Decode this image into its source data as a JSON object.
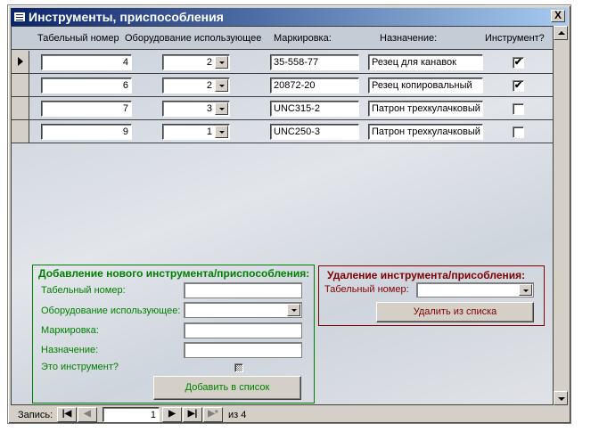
{
  "window": {
    "title": "Инструменты, приспособления",
    "close": "X"
  },
  "columns": [
    "Табельный номер",
    "Оборудование использующее",
    "Маркировка:",
    "Назначение:",
    "Инструмент?"
  ],
  "rows": [
    {
      "tab": "4",
      "equip": "2",
      "mark": "35-558-77",
      "purpose": "Резец для канавок",
      "tool": "✔",
      "current": true
    },
    {
      "tab": "6",
      "equip": "2",
      "mark": "20872-20",
      "purpose": "Резец копировальный",
      "tool": "✔",
      "current": false
    },
    {
      "tab": "7",
      "equip": "3",
      "mark": "UNC315-2",
      "purpose": "Патрон трехкулачковый",
      "tool": "",
      "current": false
    },
    {
      "tab": "9",
      "equip": "1",
      "mark": "UNC250-3",
      "purpose": "Патрон трехкулачковый",
      "tool": "",
      "current": false
    }
  ],
  "add": {
    "title": "Добавление нового инструмента/приспособления:",
    "tab_label": "Табельный номер:",
    "equip_label": "Оборудование использующее:",
    "mark_label": "Маркировка:",
    "purpose_label": "Назначение:",
    "tool_label": "Это инструмент?",
    "button": "Добавить в список",
    "color": "#008000"
  },
  "del": {
    "title": "Удаление инструмента/присобления:",
    "tab_label": "Табельный номер:",
    "button": "Удалить из списка",
    "color": "#800000"
  },
  "nav": {
    "label": "Запись:",
    "current": "1",
    "of": "из  4"
  }
}
